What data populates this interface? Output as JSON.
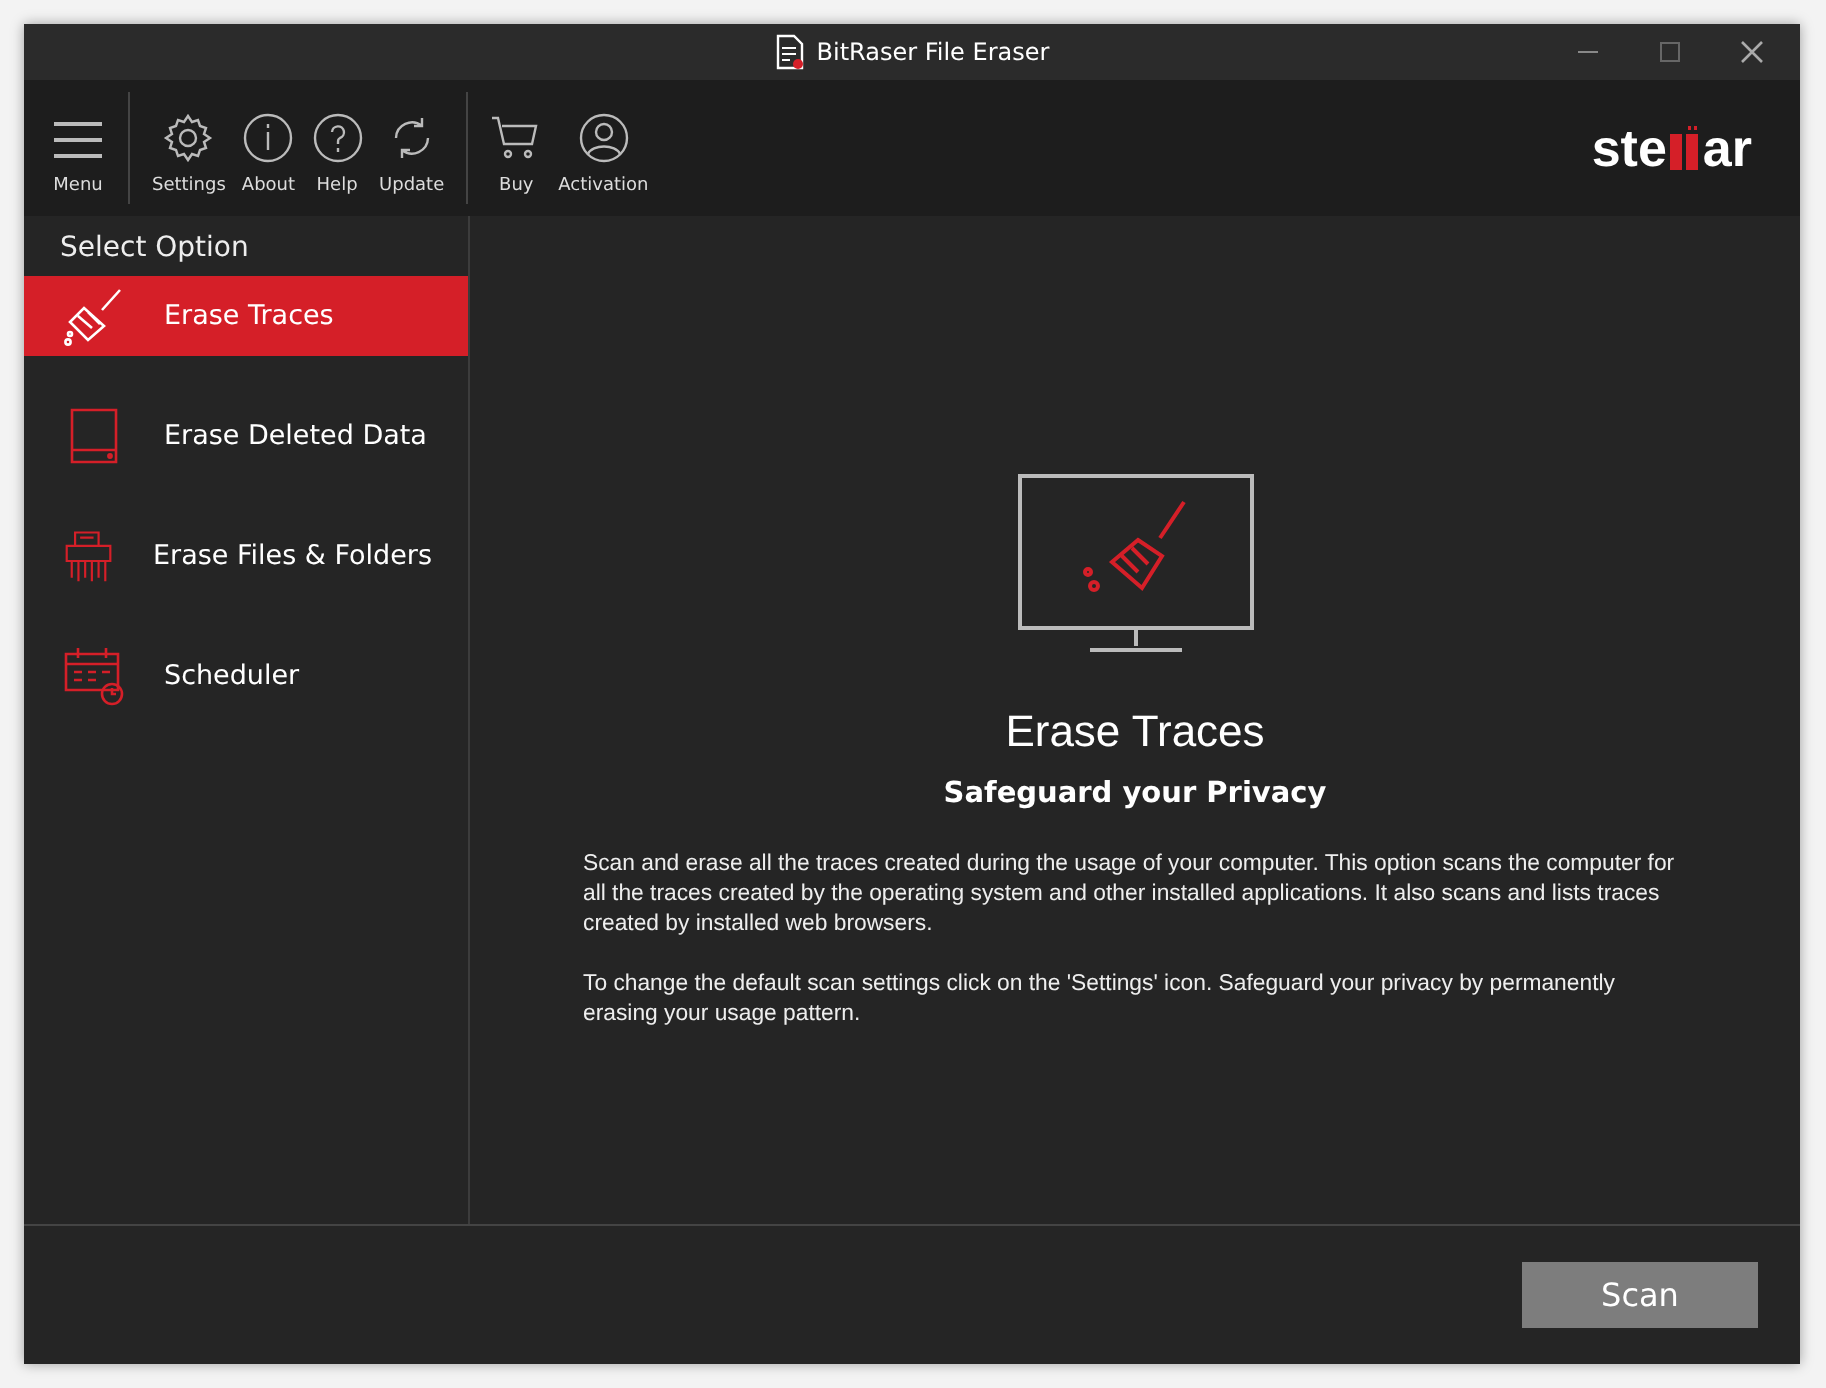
{
  "window": {
    "title": "BitRaser File Eraser"
  },
  "toolbar": {
    "menu": "Menu",
    "groups": [
      [
        {
          "label": "Settings"
        },
        {
          "label": "About"
        },
        {
          "label": "Help"
        },
        {
          "label": "Update"
        }
      ],
      [
        {
          "label": "Buy"
        },
        {
          "label": "Activation"
        }
      ]
    ],
    "logo": {
      "left": "ste",
      "right": "ar"
    }
  },
  "sidebar": {
    "title": "Select Option",
    "items": [
      {
        "label": "Erase Traces",
        "selected": true
      },
      {
        "label": "Erase Deleted Data",
        "selected": false
      },
      {
        "label": "Erase Files & Folders",
        "selected": false
      },
      {
        "label": "Scheduler",
        "selected": false
      }
    ]
  },
  "main": {
    "title": "Erase Traces",
    "subtitle": "Safeguard your Privacy",
    "paragraphs": [
      "Scan and erase all the traces created during the usage of your computer. This option scans the computer for all the traces created by the operating system and other installed applications. It also scans and lists traces created by installed web browsers.",
      "To change the default scan settings click on the 'Settings' icon. Safeguard your privacy by permanently erasing your usage pattern."
    ]
  },
  "footer": {
    "button": "Scan"
  }
}
